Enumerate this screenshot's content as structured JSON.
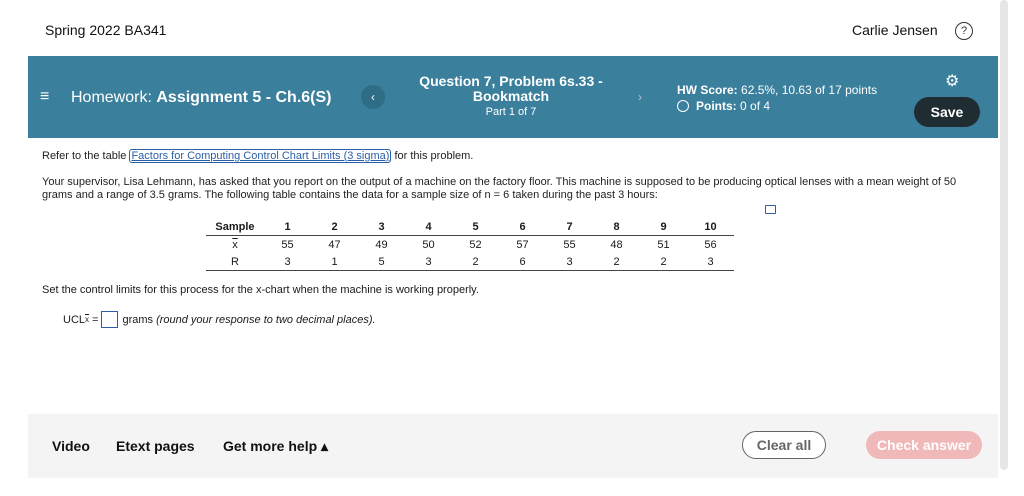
{
  "header": {
    "course": "Spring 2022 BA341",
    "user": "Carlie Jensen",
    "help_icon": "?"
  },
  "banner": {
    "menu_icon": "≡",
    "hw_label": "Homework:",
    "hw_name": "Assignment 5 - Ch.6(S)",
    "prev_icon": "‹",
    "next_icon": "›",
    "question_title": "Question 7, Problem 6s.33 - Bookmatch",
    "question_part": "Part 1 of 7",
    "hw_score_label": "HW Score:",
    "hw_score_value": "62.5%, 10.63 of 17 points",
    "points_label": "Points:",
    "points_value": "0 of 4",
    "gear_icon": "⚙",
    "save_label": "Save"
  },
  "question": {
    "refer_pre": "Refer to the table",
    "refer_link": "Factors for Computing Control Chart Limits (3 sigma)",
    "refer_post": "for this problem.",
    "scenario": "Your supervisor, Lisa Lehmann, has asked that you report on the output of a machine on the factory floor. This machine is supposed to be producing optical lenses with a mean weight of 50 grams and a range of 3.5 grams. The following table contains the data for a sample size of n = 6 taken during the past 3 hours:",
    "table": {
      "headers": [
        "Sample",
        "1",
        "2",
        "3",
        "4",
        "5",
        "6",
        "7",
        "8",
        "9",
        "10"
      ],
      "rows": [
        {
          "label": "x",
          "values": [
            "55",
            "47",
            "49",
            "50",
            "52",
            "57",
            "55",
            "48",
            "51",
            "56"
          ]
        },
        {
          "label": "R",
          "values": [
            "3",
            "1",
            "5",
            "3",
            "2",
            "6",
            "3",
            "2",
            "2",
            "3"
          ]
        }
      ]
    },
    "set_limits": "Set the control limits for this process for the x-chart when the machine is working properly.",
    "ucl_label": "UCL",
    "ucl_sub": "x",
    "ucl_eq": "=",
    "ucl_input_value": "",
    "ucl_unit": "grams",
    "ucl_hint": "(round your response to two decimal places)."
  },
  "footer": {
    "video": "Video",
    "etext": "Etext pages",
    "more_help": "Get more help ▴",
    "clear": "Clear all",
    "check": "Check answer"
  }
}
